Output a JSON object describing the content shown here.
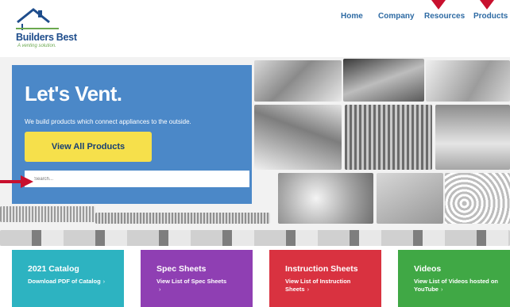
{
  "brand": {
    "name": "Builders Best",
    "tagline": "A venting solution."
  },
  "nav": {
    "home": "Home",
    "company": "Company",
    "resources": "Resources",
    "products": "Products"
  },
  "hero": {
    "title": "Let's Vent.",
    "subtitle": "We build products which connect appliances to the outside.",
    "cta_label": "View All Products",
    "search_placeholder": "Search..."
  },
  "categories": [
    {
      "title": "2021 Catalog",
      "desc": "Download PDF of Catalog",
      "chevron": "›",
      "color": "#2db3c1"
    },
    {
      "title": "Spec Sheets",
      "desc": "View List of Spec Sheets",
      "chevron": "›",
      "color": "#8f3fb3"
    },
    {
      "title": "Instruction Sheets",
      "desc": "View List of Instruction Sheets",
      "chevron": "›",
      "color": "#d93240"
    },
    {
      "title": "Videos",
      "desc": "View List of Videos hosted on YouTube",
      "chevron": "›",
      "color": "#40a845"
    }
  ],
  "colors": {
    "annotation_arrow": "#c8102e",
    "hero_panel": "#3e80c5",
    "cta": "#f6e04b",
    "nav_link": "#2d6aa3"
  },
  "icons": {
    "logo": "house-roof-icon",
    "annotation": "red-arrow-icon"
  }
}
